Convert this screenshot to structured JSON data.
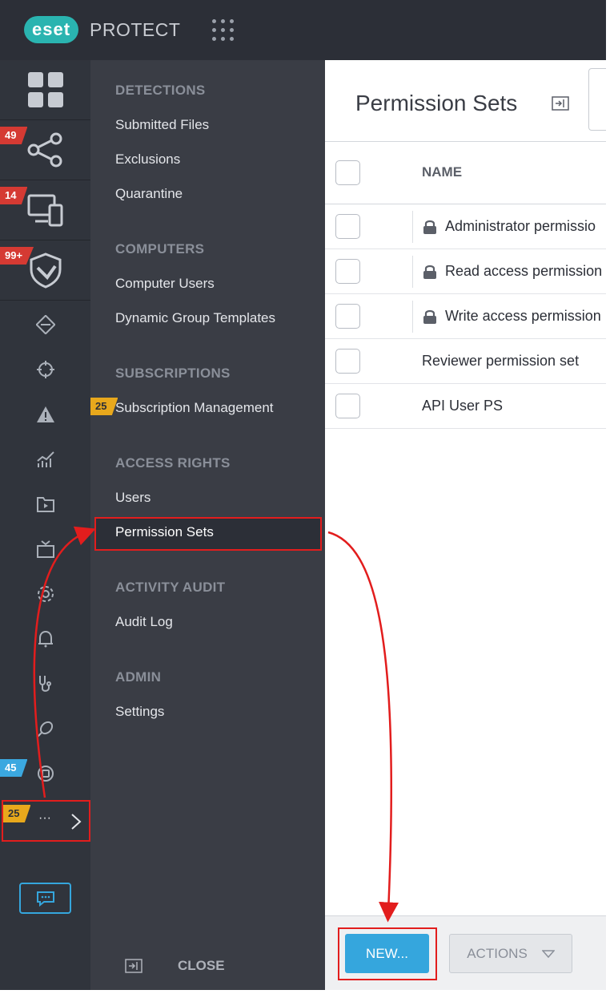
{
  "app": {
    "logo_mark": "eset",
    "logo_text": "PROTECT"
  },
  "rail": {
    "badges": {
      "topology": "49",
      "computers": "14",
      "detections": "99+",
      "helpdesk": "45",
      "more": "25"
    },
    "more_label": "···"
  },
  "menu": {
    "sections": [
      {
        "title": "DETECTIONS",
        "items": [
          "Submitted Files",
          "Exclusions",
          "Quarantine"
        ]
      },
      {
        "title": "COMPUTERS",
        "items": [
          "Computer Users",
          "Dynamic Group Templates"
        ]
      },
      {
        "title": "SUBSCRIPTIONS",
        "items": [
          "Subscription Management"
        ]
      },
      {
        "title": "ACCESS RIGHTS",
        "items": [
          "Users",
          "Permission Sets"
        ]
      },
      {
        "title": "ACTIVITY AUDIT",
        "items": [
          "Audit Log"
        ]
      },
      {
        "title": "ADMIN",
        "items": [
          "Settings"
        ]
      }
    ],
    "subscription_badge": "25",
    "close_label": "CLOSE"
  },
  "main": {
    "title": "Permission Sets",
    "table": {
      "column_name": "NAME",
      "rows": [
        {
          "name": "Administrator permissio",
          "locked": true
        },
        {
          "name": "Read access permission",
          "locked": true
        },
        {
          "name": "Write access permission",
          "locked": true
        },
        {
          "name": "Reviewer permission set",
          "locked": false
        },
        {
          "name": "API User PS",
          "locked": false
        }
      ]
    }
  },
  "footer": {
    "new_label": "NEW...",
    "actions_label": "ACTIONS"
  },
  "colors": {
    "accent": "#35a6dd",
    "highlight": "#e21d1d",
    "teal": "#2ab4b0"
  }
}
